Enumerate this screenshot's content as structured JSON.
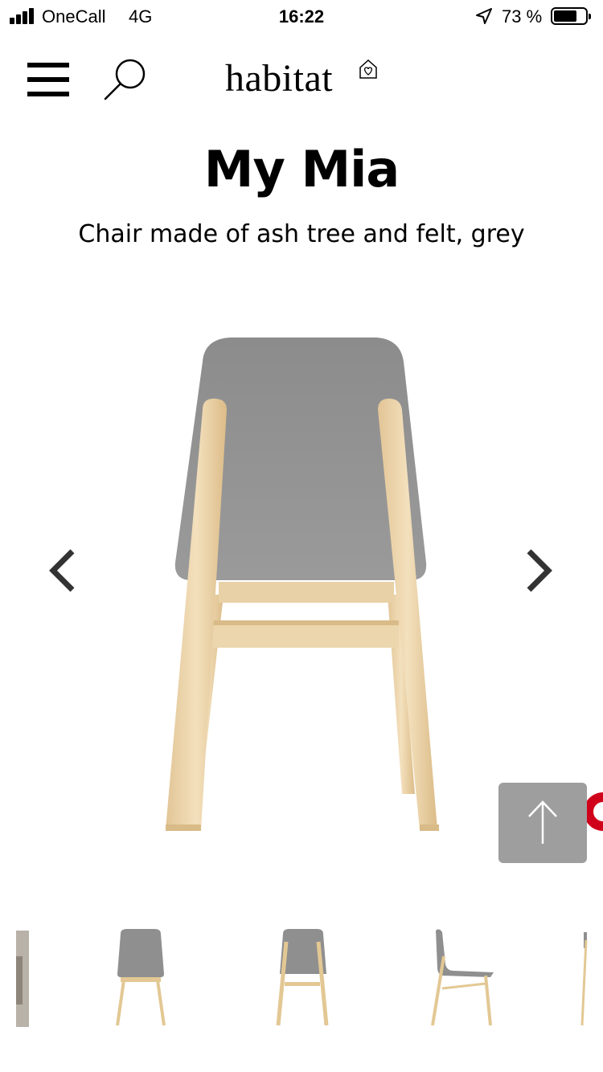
{
  "status_bar": {
    "carrier": "OneCall",
    "network": "4G",
    "time": "16:22",
    "battery_percent": "73 %",
    "battery_level": 0.73,
    "icons": [
      "signal-bars-icon",
      "location-arrow-icon",
      "battery-icon"
    ]
  },
  "header": {
    "logo_text": "habitat",
    "icons": [
      "hamburger-menu-icon",
      "search-icon",
      "house-heart-icon"
    ]
  },
  "product": {
    "name": "My Mia",
    "description": "Chair made of ash tree and felt, grey"
  },
  "carousel": {
    "icons": [
      "chevron-left-icon",
      "chevron-right-icon",
      "arrow-up-icon"
    ],
    "thumbnail_count": 5
  },
  "colors": {
    "felt_grey": "#8f8f8f",
    "ash_wood": "#ead3a8",
    "back_to_top_bg": "#9e9e9e",
    "badge_red": "#d0021b",
    "chevron": "#333333"
  }
}
